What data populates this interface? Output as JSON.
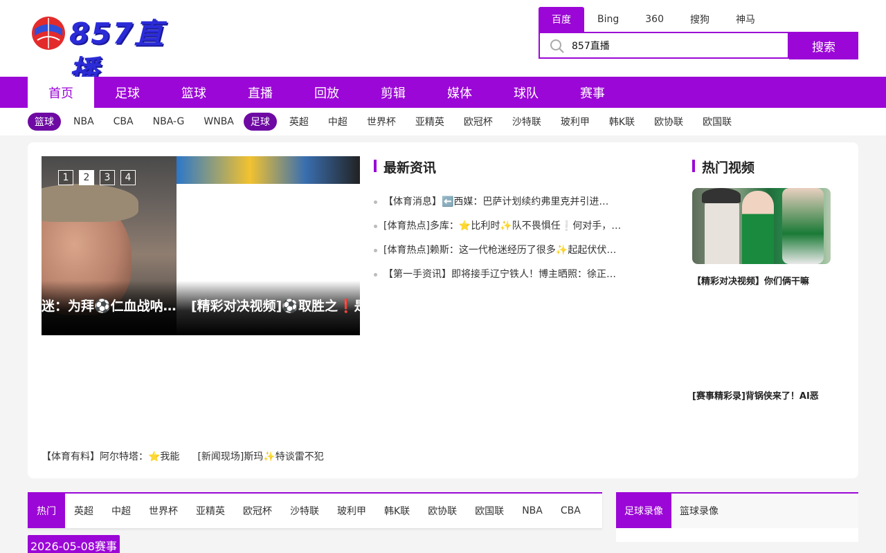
{
  "logo": {
    "text": "857直播"
  },
  "search": {
    "tabs": [
      "百度",
      "Bing",
      "360",
      "搜狗",
      "神马"
    ],
    "active_tab": 0,
    "query": "857直播",
    "button_label": "搜索"
  },
  "main_nav": {
    "items": [
      "首页",
      "足球",
      "篮球",
      "直播",
      "回放",
      "剪辑",
      "媒体",
      "球队",
      "赛事"
    ],
    "active": 0
  },
  "sub_nav": {
    "groups": [
      {
        "pill": "篮球",
        "items": [
          "NBA",
          "CBA",
          "NBA-G",
          "WNBA"
        ]
      },
      {
        "pill": "足球",
        "items": [
          "英超",
          "中超",
          "世界杯",
          "亚精英",
          "欧冠杯",
          "沙特联",
          "玻利甲",
          "韩K联",
          "欧协联",
          "欧国联"
        ]
      }
    ]
  },
  "slider": {
    "dots": [
      "1",
      "2",
      "3",
      "4"
    ],
    "active_dot": 1,
    "caption_left": "迷：为拜⚽仁血战呐…",
    "caption_right": "[精彩对决视频]⚽取胜之❗是"
  },
  "latest_news": {
    "title": "最新资讯",
    "items": [
      "【体育消息】⬅️西媒：巴萨计划续约弗里克并引进…",
      "[体育热点]多库：⭐比利时✨队不畏惧任❕何对手，…",
      "[体育热点]赖斯：这一代枪迷经历了很多✨起起伏伏…",
      "【第一手资讯】即将接手辽宁铁人！博主晒照：徐正…"
    ]
  },
  "hot_videos": {
    "title": "热门视频",
    "items": [
      "【精彩对决视频】你们俩干嘛",
      "[赛事精彩录]背锅侠来了！AI恶"
    ]
  },
  "bottom_links": [
    "【体育有料】阿尔特塔：⭐我能",
    "[新闻现场]斯玛✨特谈雷不犯"
  ],
  "match_tabs": {
    "items": [
      "热门",
      "英超",
      "中超",
      "世界杯",
      "亚精英",
      "欧冠杯",
      "沙特联",
      "玻利甲",
      "韩K联",
      "欧协联",
      "欧国联",
      "NBA",
      "CBA"
    ],
    "active": 0
  },
  "replay_tabs": {
    "items": [
      "足球录像",
      "篮球录像"
    ],
    "active": 0
  },
  "date_badge": "2026-05-08赛事",
  "colors": {
    "accent": "#9b07d6",
    "pill": "#6e0aa3",
    "background": "#f4f4f4"
  }
}
